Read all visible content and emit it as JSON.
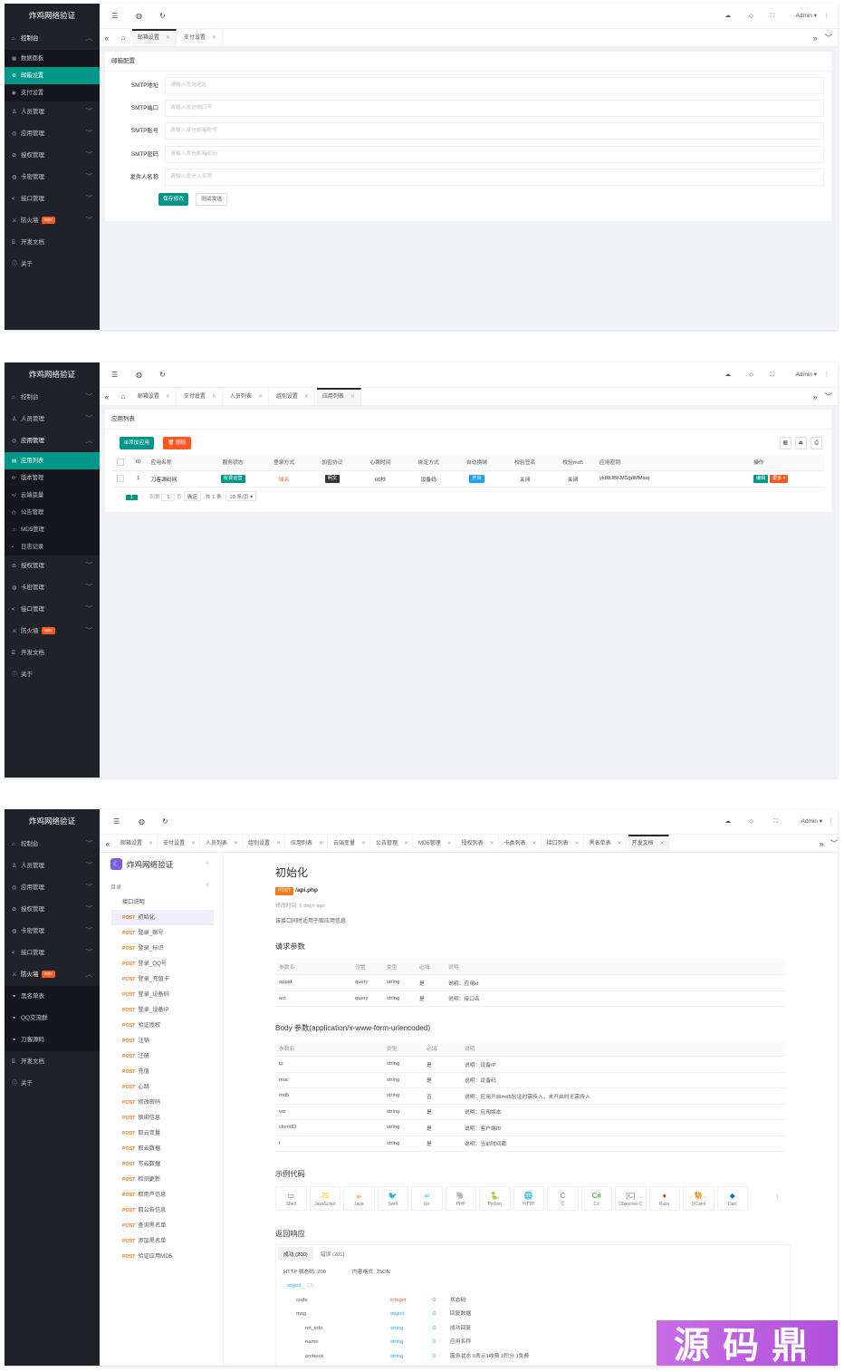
{
  "app_name": "炸鸡网络验证",
  "icons": {
    "menu": "menu-icon",
    "globe": "globe-icon",
    "refresh": "refresh-icon",
    "theme": "theme-icon",
    "tag": "tag-icon",
    "fullscreen": "fullscreen-icon",
    "more": "more-icon",
    "home": "home-icon",
    "close": "close-icon"
  },
  "colors": {
    "sidebar": "#20222a",
    "accent": "#009688",
    "danger": "#ff5722",
    "blue": "#1e9fff"
  },
  "top": {
    "user": "Admin ▾",
    "more": "⋮"
  },
  "sidebar1": {
    "control": "控制台",
    "control_sub": [
      "数据面板",
      "邮箱设置",
      "支付设置"
    ],
    "items": [
      "人员管理",
      "应用管理",
      "授权管理",
      "卡密管理",
      "接口管理",
      "防火墙",
      "开发文档",
      "关于"
    ],
    "new_badge": "new"
  },
  "screen1": {
    "tabs": [
      "邮箱设置",
      "支付设置"
    ],
    "card_title": "邮箱配置",
    "fields": [
      {
        "label": "SMTP地址",
        "placeholder": "请输入发信地址"
      },
      {
        "label": "SMTP端口",
        "placeholder": "请输入发信端口号"
      },
      {
        "label": "SMTP账号",
        "placeholder": "请输入发信邮箱账号"
      },
      {
        "label": "SMTP密码",
        "placeholder": "请输入发信邮箱密码"
      },
      {
        "label": "发件人名称",
        "placeholder": "请输入发信人名称"
      }
    ],
    "save_button": "保存修改",
    "test_button": "测试发送"
  },
  "sidebar2": {
    "top_items": [
      "控制台",
      "人员管理"
    ],
    "app_mgmt": "应用管理",
    "app_sub": [
      "应用列表",
      "版本管理",
      "云端变量",
      "公告管理",
      "MD5管理",
      "日志记录"
    ],
    "bottom_items": [
      "授权管理",
      "卡密管理",
      "接口管理",
      "防火墙",
      "开发文档",
      "关于"
    ],
    "new_badge": "new"
  },
  "screen2": {
    "tabs": [
      "邮箱设置",
      "支付设置",
      "人员列表",
      "组别设置",
      "应用列表"
    ],
    "card_title": "应用列表",
    "add_button": "⊕添加应用",
    "delete_button": "🗑 删除",
    "columns": [
      "ID",
      "应用名称",
      "服务状态",
      "登录方式",
      "加密协议",
      "心跳时间",
      "绑定方式",
      "自动换绑",
      "校验签名",
      "校验md5",
      "应用密钥",
      "操作"
    ],
    "row": {
      "id": "1",
      "name": "刀客源码网",
      "status": "收费运营",
      "login": "域名",
      "protocol": "明文",
      "heartbeat": "60秒",
      "bind": "设备码",
      "auto_rebind": "开启",
      "check_sign": "关闭",
      "check_md5": "关闭",
      "key": "yk88JBKMSgdMMisq",
      "edit": "编辑",
      "more": "更多 ▾"
    },
    "pager": {
      "prev": "‹",
      "page": "1",
      "next": "›",
      "goto_label": "到第",
      "goto_value": "1",
      "page_unit": "页",
      "confirm": "确定",
      "total": "共 1 条",
      "per_page": "10 条/页 ▾"
    }
  },
  "sidebar3": {
    "items_top": [
      "控制台",
      "人员管理",
      "应用管理",
      "授权管理",
      "卡密管理",
      "接口管理"
    ],
    "firewall": "防火墙",
    "firewall_sub": [
      "黑名单表",
      "QQ交流群",
      "刀客源码"
    ],
    "items_bottom": [
      "开发文档",
      "关于"
    ],
    "new_badge": "new"
  },
  "screen3": {
    "tabs": [
      "邮箱设置",
      "支付设置",
      "人员列表",
      "组别设置",
      "应用列表",
      "云端变量",
      "公告管理",
      "MD5管理",
      "授权列表",
      "卡类列表",
      "接口列表",
      "黑名单表",
      "开发文档"
    ],
    "doc_title": "炸鸡网络验证",
    "toc_label": "目录",
    "nav": [
      {
        "m": "",
        "t": "接口说明"
      },
      {
        "m": "POST",
        "t": "初始化"
      },
      {
        "m": "POST",
        "t": "登录_账号"
      },
      {
        "m": "POST",
        "t": "登录_标识"
      },
      {
        "m": "POST",
        "t": "登录_QQ号"
      },
      {
        "m": "POST",
        "t": "登录_充值卡"
      },
      {
        "m": "POST",
        "t": "登录_设备码"
      },
      {
        "m": "POST",
        "t": "登录_设备IP"
      },
      {
        "m": "POST",
        "t": "验证授权"
      },
      {
        "m": "POST",
        "t": "注销"
      },
      {
        "m": "POST",
        "t": "注册"
      },
      {
        "m": "POST",
        "t": "充值"
      },
      {
        "m": "POST",
        "t": "心跳"
      },
      {
        "m": "POST",
        "t": "修改密码"
      },
      {
        "m": "POST",
        "t": "换绑信息"
      },
      {
        "m": "POST",
        "t": "取云变量"
      },
      {
        "m": "POST",
        "t": "取云数据"
      },
      {
        "m": "POST",
        "t": "写云数据"
      },
      {
        "m": "POST",
        "t": "检测更新"
      },
      {
        "m": "POST",
        "t": "取用户信息"
      },
      {
        "m": "POST",
        "t": "取公告信息"
      },
      {
        "m": "POST",
        "t": "查询黑名单"
      },
      {
        "m": "POST",
        "t": "添加黑名单"
      },
      {
        "m": "POST",
        "t": "验证应用MD5"
      }
    ],
    "api_title": "初始化",
    "method": "POST",
    "path": "/api.php",
    "modified": "修改时间: 6 days ago",
    "desc": "该接口同时适用于取应用信息",
    "req_title": "请求参数",
    "req_cols": [
      "参数名",
      "位置",
      "类型",
      "必填",
      "说明"
    ],
    "req_rows": [
      [
        "appid",
        "query",
        "string",
        "是",
        "说明：应用id"
      ],
      [
        "act",
        "query",
        "string",
        "是",
        "说明：接口名"
      ]
    ],
    "body_title": "Body 参数(application/x-www-form-urlencoded)",
    "body_cols": [
      "参数名",
      "类型",
      "必填",
      "说明"
    ],
    "body_rows": [
      [
        "ip",
        "string",
        "是",
        "说明：设备IP"
      ],
      [
        "mac",
        "string",
        "是",
        "说明：设备码"
      ],
      [
        "md5",
        "string",
        "否",
        "说明：应用开启md5验证时需传入，未开启时无需传入"
      ],
      [
        "ver",
        "string",
        "是",
        "说明：应用版本"
      ],
      [
        "clientID",
        "string",
        "是",
        "说明：客户端ID"
      ],
      [
        "t",
        "string",
        "是",
        "说明：当前时间戳"
      ]
    ],
    "code_title": "示例代码",
    "langs": [
      "Shell",
      "JavaScript",
      "Java",
      "Swift",
      "Go",
      "PHP",
      "Python",
      "HTTP",
      "C",
      "C#",
      "Objective-C",
      "Ruby",
      "OCaml",
      "Dart"
    ],
    "resp_title": "返回响应",
    "resp_tabs": [
      "成功 (200)",
      "错误 (201)"
    ],
    "http_status": "HTTP 状态码: 200",
    "content_type": "内容格式: JSON",
    "schema": [
      {
        "k": "object",
        "n": "(3)",
        "type": "",
        "d": ""
      },
      {
        "k": "code",
        "n": "",
        "type": "integer",
        "d": "状态码"
      },
      {
        "k": "msg",
        "n": "",
        "type": "object",
        "d": "回复数据"
      },
      {
        "k": "ret_info",
        "n": "",
        "type": "string",
        "d": "成功回复"
      },
      {
        "k": "name",
        "n": "",
        "type": "string",
        "d": "应用名称"
      },
      {
        "k": "orcheck",
        "n": "",
        "type": "string",
        "d": "服务状态 0表示1收费 2积分 1免费"
      }
    ]
  },
  "watermark": "源码鼎"
}
